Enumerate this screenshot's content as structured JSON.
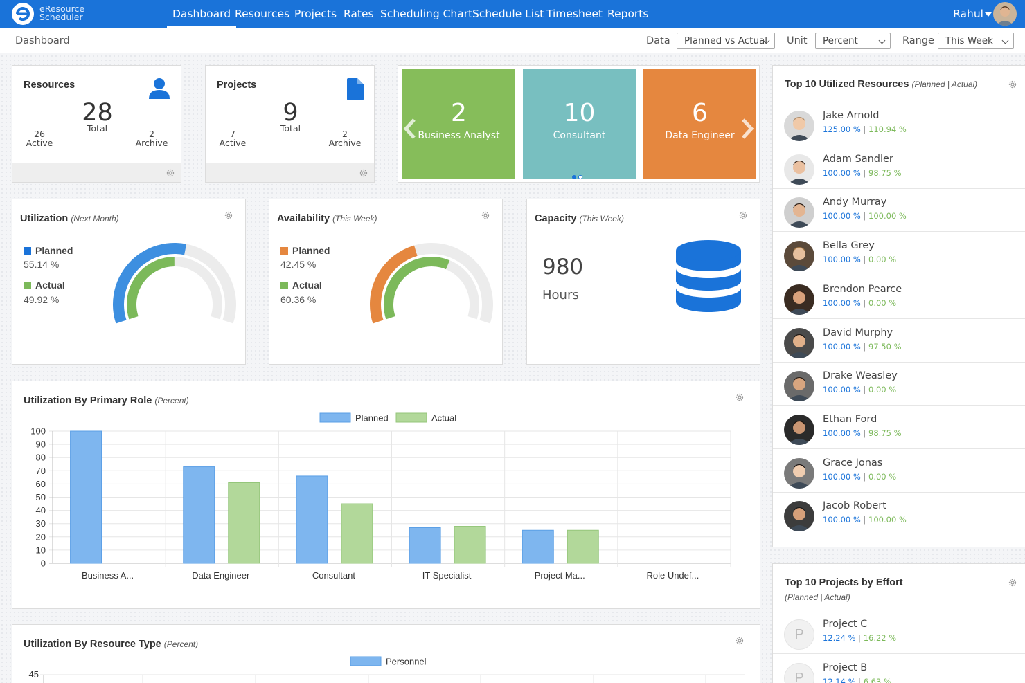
{
  "app": {
    "logo_line1": "eResource",
    "logo_line2": "Scheduler"
  },
  "nav": {
    "items": [
      "Dashboard",
      "Resources",
      "Projects",
      "Rates",
      "Scheduling Chart",
      "Schedule List",
      "Timesheet",
      "Reports"
    ],
    "active": "Dashboard"
  },
  "user": {
    "name": "Rahul"
  },
  "subbar": {
    "breadcrumb": "Dashboard",
    "data_label": "Data",
    "data_value": "Planned vs Actual",
    "unit_label": "Unit",
    "unit_value": "Percent",
    "range_label": "Range",
    "range_value": "This Week"
  },
  "resources_card": {
    "title": "Resources",
    "total": "28",
    "total_label": "Total",
    "active": "26",
    "active_label": "Active",
    "archive": "2",
    "archive_label": "Archive"
  },
  "projects_card": {
    "title": "Projects",
    "total": "9",
    "total_label": "Total",
    "active": "7",
    "active_label": "Active",
    "archive": "2",
    "archive_label": "Archive"
  },
  "role_tiles": [
    {
      "count": "2",
      "label": "Business Analyst",
      "color": "#86bd5a"
    },
    {
      "count": "10",
      "label": "Consultant",
      "color": "#78bfc0"
    },
    {
      "count": "6",
      "label": "Data Engineer",
      "color": "#e5873f"
    }
  ],
  "utilization": {
    "title": "Utilization",
    "subtitle": "(Next Month)",
    "planned_label": "Planned",
    "planned": "55.14 %",
    "planned_pct": 55.14,
    "actual_label": "Actual",
    "actual": "49.92 %",
    "actual_pct": 49.92,
    "planned_color": "#3d8fe0",
    "actual_color": "#7cb95a"
  },
  "availability": {
    "title": "Availability",
    "subtitle": "(This Week)",
    "planned_label": "Planned",
    "planned": "42.45 %",
    "planned_pct": 42.45,
    "actual_label": "Actual",
    "actual": "60.36 %",
    "actual_pct": 60.36,
    "planned_color": "#e5873f",
    "actual_color": "#7cb95a"
  },
  "capacity": {
    "title": "Capacity",
    "subtitle": "(This Week)",
    "value": "980",
    "unit": "Hours"
  },
  "role_chart": {
    "title": "Utilization By Primary Role",
    "subtitle": "(Percent)"
  },
  "type_chart": {
    "title": "Utilization By Resource Type",
    "subtitle": "(Percent)"
  },
  "chart_data": [
    {
      "type": "bar",
      "categories": [
        "Business A...",
        "Data Engineer",
        "Consultant",
        "IT Specialist",
        "Project Ma...",
        "Role Undef..."
      ],
      "series": [
        {
          "name": "Planned",
          "values": [
            100,
            73,
            66,
            27,
            25,
            0
          ],
          "color": "#7eb6ef"
        },
        {
          "name": "Actual",
          "values": [
            0,
            61,
            45,
            28,
            25,
            0
          ],
          "color": "#b2d89a"
        }
      ],
      "ylim": [
        0,
        100
      ],
      "yticks": [
        0,
        10,
        20,
        30,
        40,
        50,
        60,
        70,
        80,
        90,
        100
      ],
      "grid": true,
      "legend": "top-center"
    },
    {
      "type": "bar",
      "series": [
        {
          "name": "Personnel",
          "color": "#7eb6ef"
        }
      ],
      "yticks": [
        45
      ],
      "legend": "top-center"
    }
  ],
  "top_resources": {
    "title": "Top 10 Utilized Resources",
    "subtitle": "(Planned | Actual)",
    "items": [
      {
        "name": "Jake Arnold",
        "planned": "125.00 %",
        "actual": "110.94 %"
      },
      {
        "name": "Adam Sandler",
        "planned": "100.00 %",
        "actual": "98.75 %"
      },
      {
        "name": "Andy Murray",
        "planned": "100.00 %",
        "actual": "100.00 %"
      },
      {
        "name": "Bella Grey",
        "planned": "100.00 %",
        "actual": "0.00 %"
      },
      {
        "name": "Brendon Pearce",
        "planned": "100.00 %",
        "actual": "0.00 %"
      },
      {
        "name": "David Murphy",
        "planned": "100.00 %",
        "actual": "97.50 %"
      },
      {
        "name": "Drake Weasley",
        "planned": "100.00 %",
        "actual": "0.00 %"
      },
      {
        "name": "Ethan Ford",
        "planned": "100.00 %",
        "actual": "98.75 %"
      },
      {
        "name": "Grace Jonas",
        "planned": "100.00 %",
        "actual": "0.00 %"
      },
      {
        "name": "Jacob Robert",
        "planned": "100.00 %",
        "actual": "100.00 %"
      }
    ]
  },
  "top_projects": {
    "title": "Top 10 Projects by Effort",
    "subtitle": "(Planned | Actual)",
    "items": [
      {
        "initial": "P",
        "name": "Project C",
        "planned": "12.24 %",
        "actual": "16.22 %"
      },
      {
        "initial": "P",
        "name": "Project B",
        "planned": "12.14 %",
        "actual": "6.63 %"
      }
    ]
  }
}
